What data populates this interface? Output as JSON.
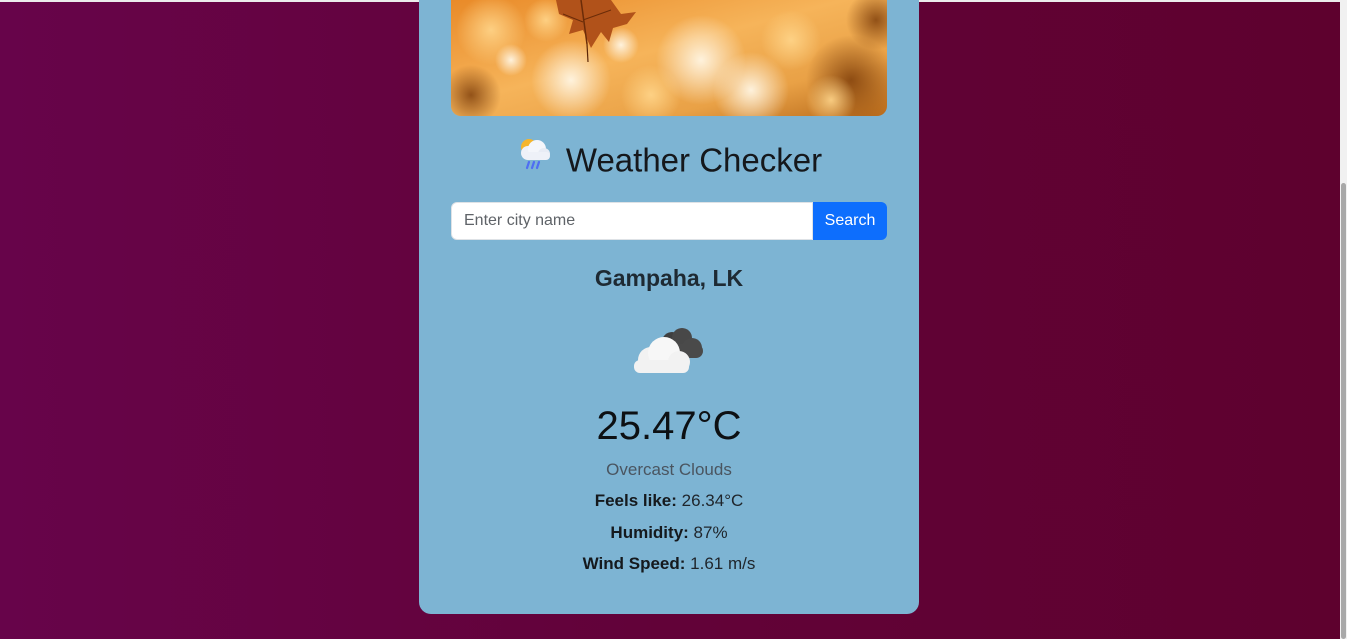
{
  "app": {
    "title": "Weather Checker",
    "title_icon": "sun-behind-rain-cloud-icon"
  },
  "search": {
    "placeholder": "Enter city name",
    "value": "",
    "button_label": "Search"
  },
  "weather": {
    "city": "Gampaha, LK",
    "icon": "overcast-clouds-icon",
    "temperature": "25.47°C",
    "description": "Overcast Clouds",
    "feels_like_label": "Feels like:",
    "feels_like_value": "26.34°C",
    "humidity_label": "Humidity:",
    "humidity_value": "87%",
    "wind_label": "Wind Speed:",
    "wind_value": "1.61 m/s"
  },
  "hero_image": "autumn-leaf-photo",
  "colors": {
    "background_start": "#67044a",
    "background_end": "#5e012e",
    "card": "#7db4d3",
    "search_button": "#0d6efd"
  }
}
